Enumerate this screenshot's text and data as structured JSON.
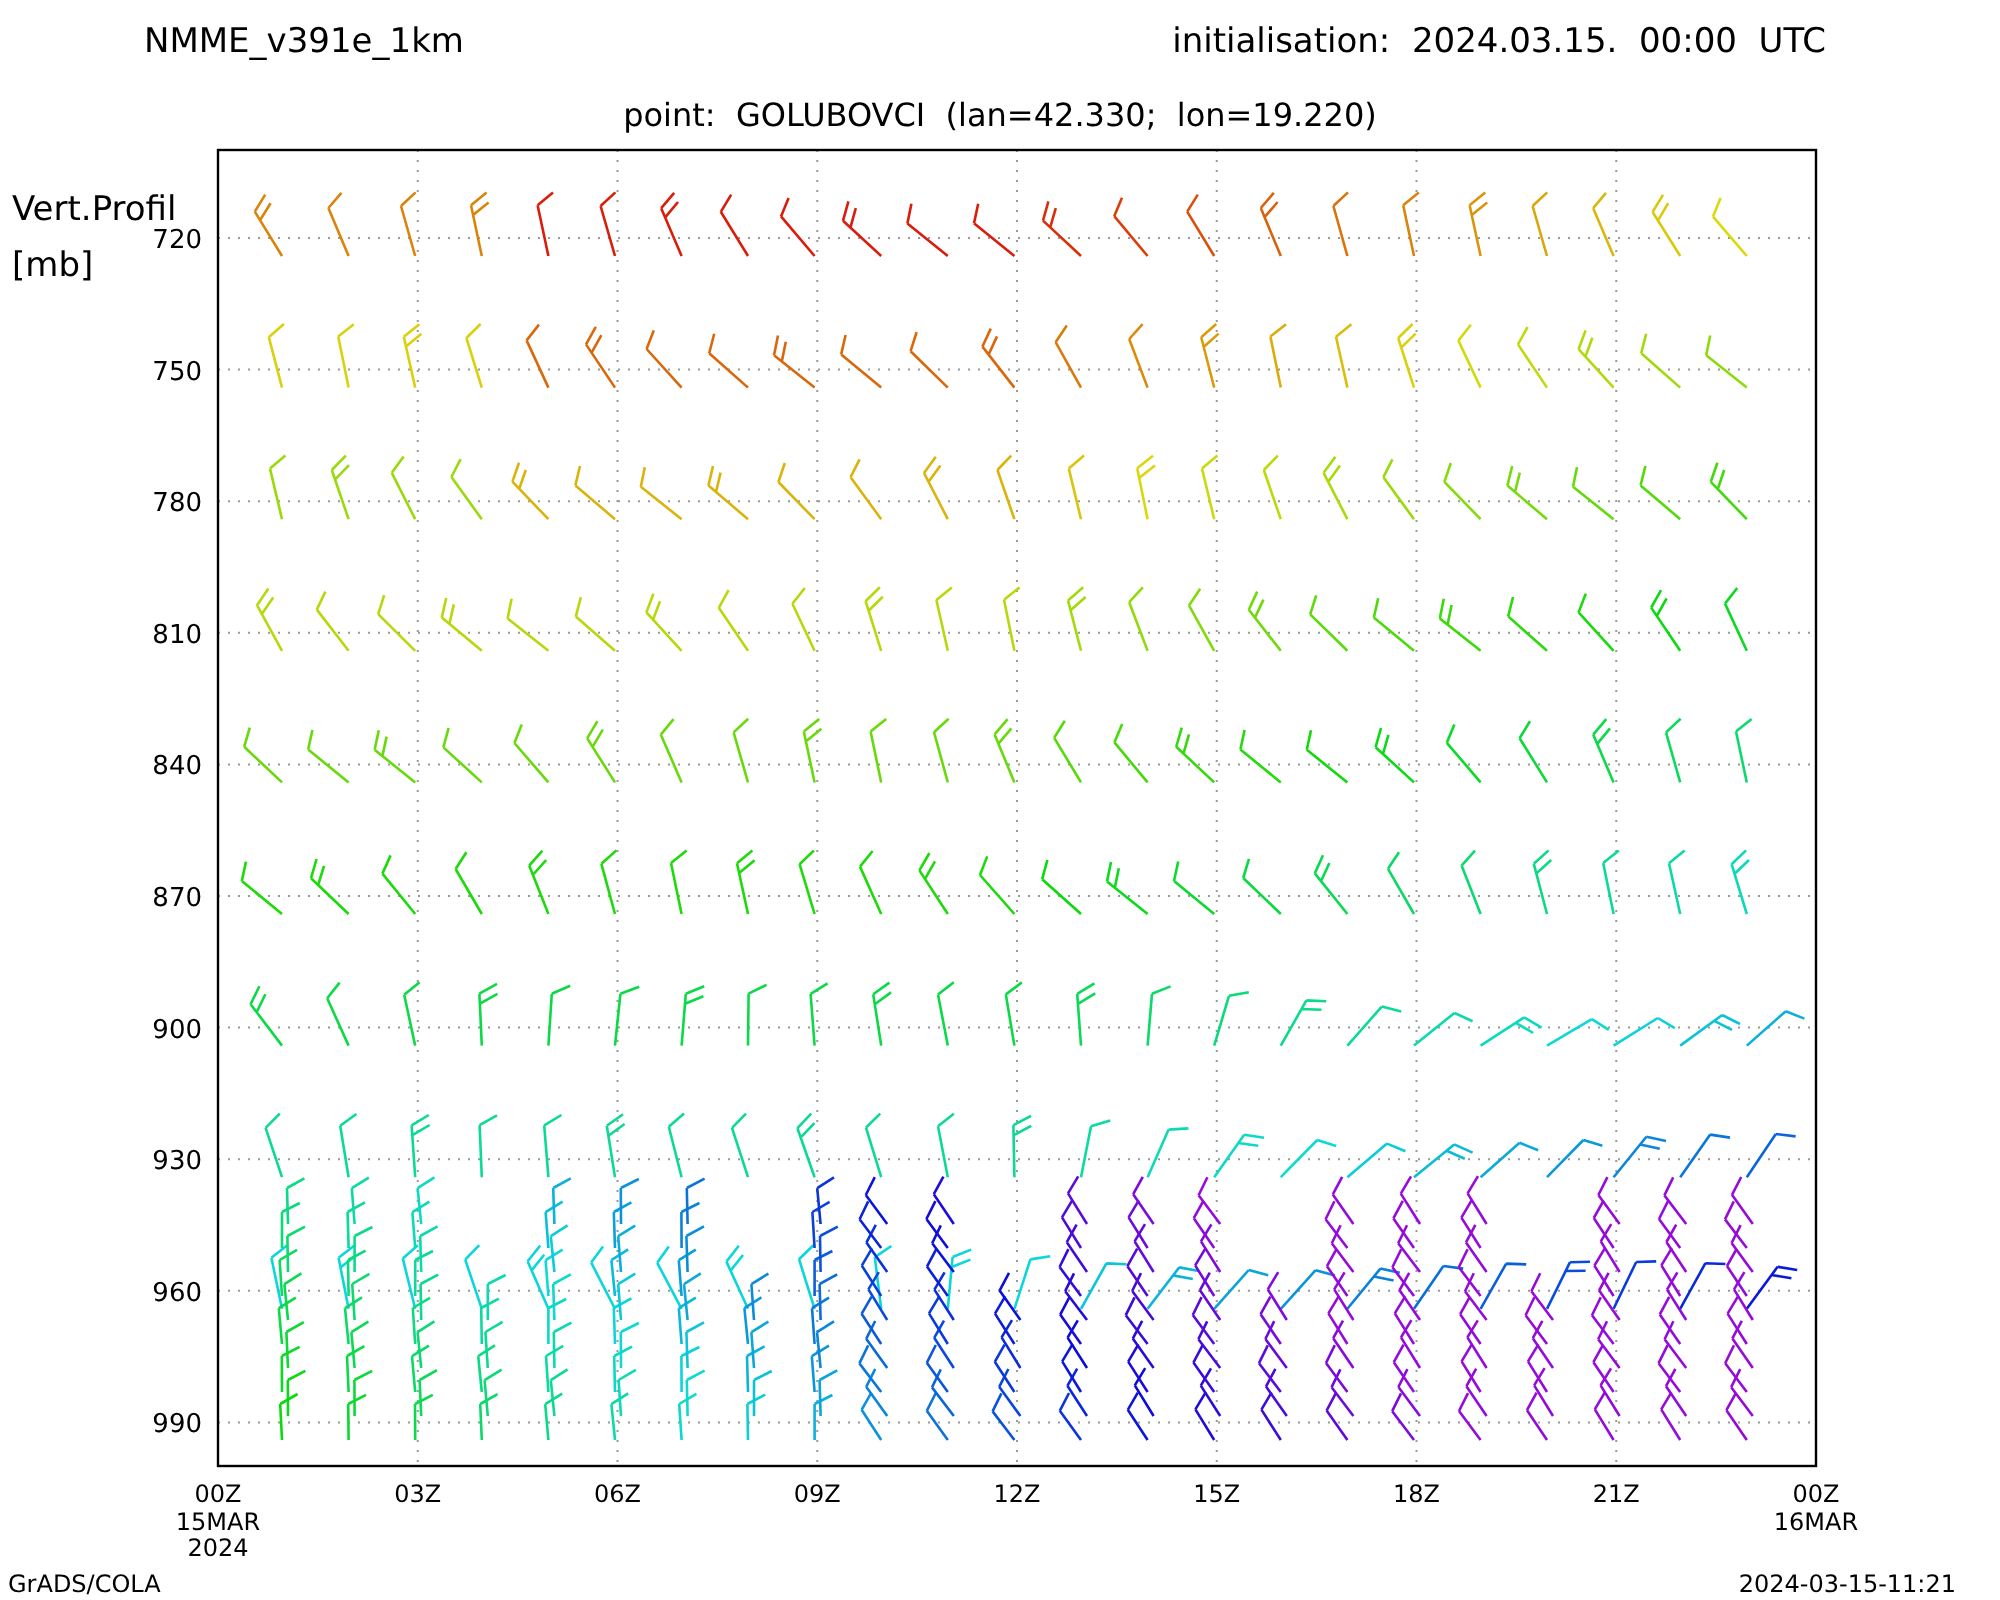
{
  "header": {
    "model": "NMME_v391e_1km",
    "initialisation": "initialisation:  2024.03.15.  00:00  UTC",
    "point": "point:  GOLUBOVCI  (lan=42.330;  lon=19.220)"
  },
  "y_axis": {
    "title": "Vert.Profil",
    "unit": "[mb]",
    "ticks": [
      "720",
      "750",
      "780",
      "810",
      "840",
      "870",
      "900",
      "930",
      "960",
      "990"
    ]
  },
  "x_axis": {
    "ticks": [
      {
        "label": "00Z",
        "sub": [
          "15MAR",
          "2024"
        ]
      },
      {
        "label": "03Z"
      },
      {
        "label": "06Z"
      },
      {
        "label": "09Z"
      },
      {
        "label": "12Z"
      },
      {
        "label": "15Z"
      },
      {
        "label": "18Z"
      },
      {
        "label": "21Z"
      },
      {
        "label": "00Z",
        "sub": [
          "16MAR"
        ]
      }
    ]
  },
  "footer": {
    "left": "GrADS/COLA",
    "right": "2024-03-15-11:21"
  }
}
